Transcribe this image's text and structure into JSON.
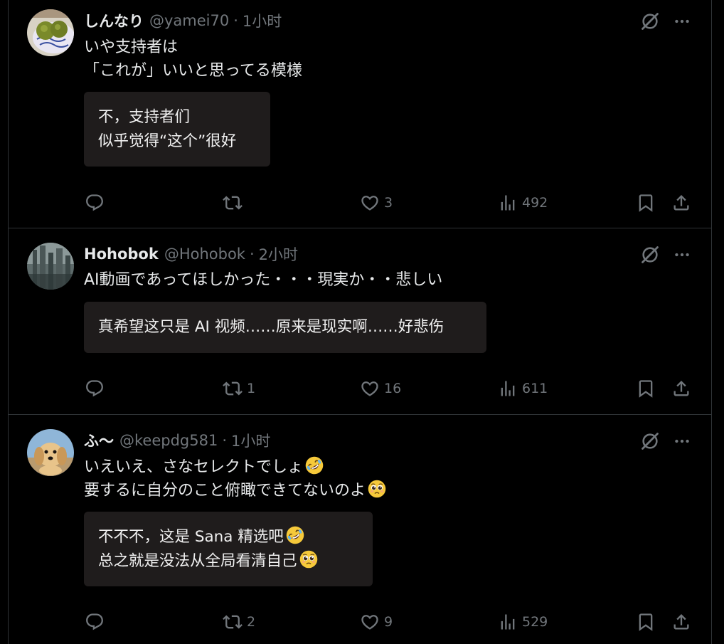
{
  "tweets": [
    {
      "name": "しんなり",
      "handle": "@yamei70",
      "dot": "·",
      "time": "1小时",
      "text": "いや支持者は\n「これが」いいと思ってる模様",
      "translation": "不，支持者们\n似乎觉得“这个”很好",
      "replies": "",
      "retweets": "",
      "likes": "3",
      "views": "492",
      "avatar": "plate-with-fruit"
    },
    {
      "name": "Hohobok",
      "handle": "@Hohobok",
      "dot": "·",
      "time": "2小时",
      "text": "AI動画であってほしかった・・・現実か・・悲しい",
      "translation": "真希望这只是 AI 视频……原来是现实啊……好悲伤",
      "replies": "",
      "retweets": "1",
      "likes": "16",
      "views": "611",
      "avatar": "city-photo"
    },
    {
      "name": "ふ〜",
      "handle": "@keepdg581",
      "dot": "·",
      "time": "1小时",
      "text_line1": "いえいえ、さなセレクトでしょ",
      "text_line2": "要するに自分のこと俯瞰できてないのよ",
      "translation_line1": "不不不，这是 Sana 精选吧",
      "translation_line2": "总之就是没法从全局看清自己",
      "replies": "",
      "retweets": "2",
      "likes": "9",
      "views": "529",
      "avatar": "puppy-photo",
      "emoji1": "rolling-on-floor-laughing-emoji",
      "emoji2": "pleading-face-emoji"
    }
  ],
  "colors": {
    "background": "#000000",
    "text": "#e7e9ea",
    "secondary": "#71767b",
    "translation_bg": "#1f1c1c",
    "divider": "#2f3336"
  }
}
